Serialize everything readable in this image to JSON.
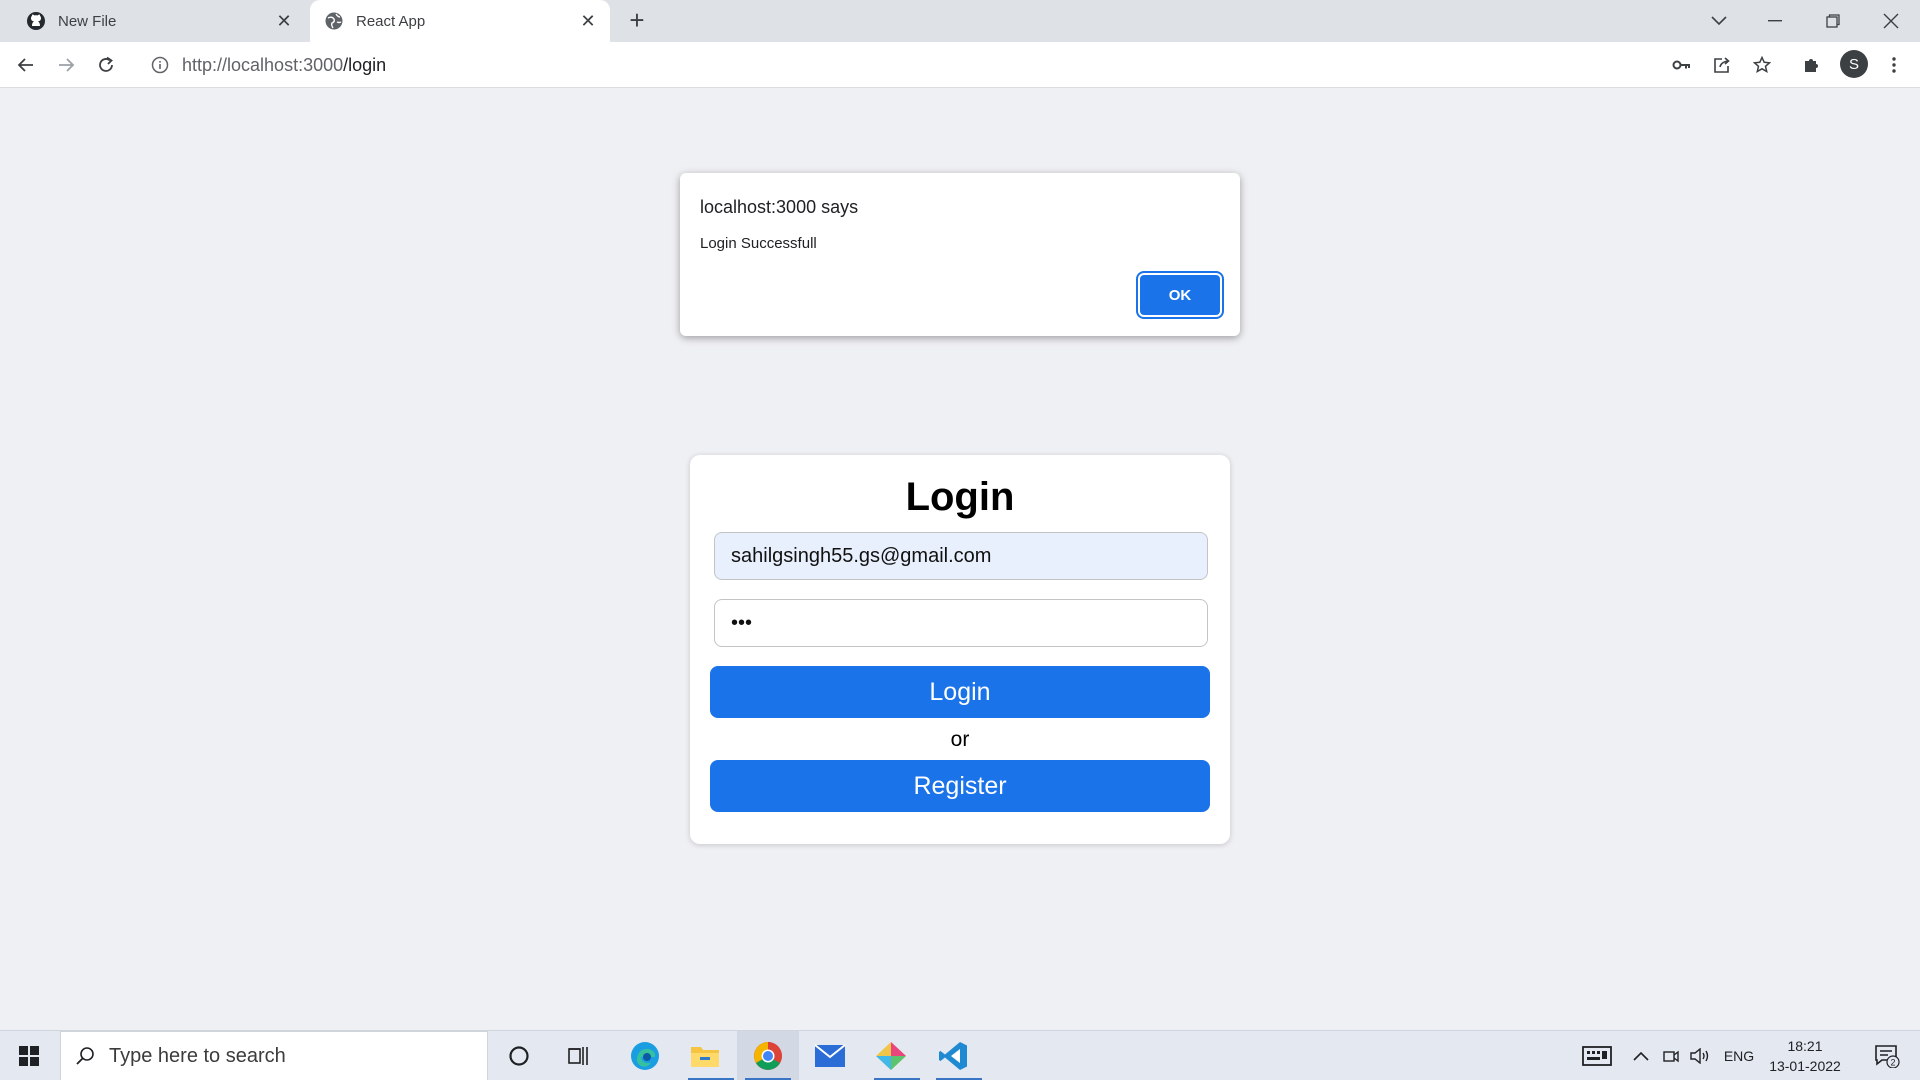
{
  "browser": {
    "tabs": [
      {
        "title": "New File",
        "favicon": "github-icon"
      },
      {
        "title": "React App",
        "favicon": "globe-icon"
      }
    ],
    "url_origin": "http://localhost:3000",
    "url_path": "/login",
    "profile_initial": "S"
  },
  "alert": {
    "origin": "localhost:3000 says",
    "message": "Login Successfull",
    "ok_label": "OK"
  },
  "login": {
    "title": "Login",
    "email_value": "sahilgsingh55.gs@gmail.com",
    "password_value": "abc",
    "login_label": "Login",
    "or_text": "or",
    "register_label": "Register"
  },
  "taskbar": {
    "search_placeholder": "Type here to search",
    "language": "ENG",
    "time": "18:21",
    "date": "13-01-2022",
    "notification_count": "2"
  },
  "colors": {
    "accent": "#1a73e8",
    "page_bg": "#eff0f4",
    "autofill_bg": "#e8f0fe"
  }
}
